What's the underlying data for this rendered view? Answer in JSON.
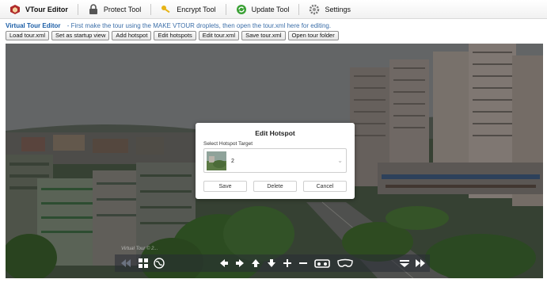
{
  "menu": {
    "items": [
      {
        "label": "VTour Editor",
        "icon": "vtour-logo-icon",
        "active": true
      },
      {
        "label": "Protect Tool",
        "icon": "lock-icon"
      },
      {
        "label": "Encrypt Tool",
        "icon": "key-icon"
      },
      {
        "label": "Update Tool",
        "icon": "update-icon"
      },
      {
        "label": "Settings",
        "icon": "gear-icon"
      }
    ]
  },
  "info": {
    "title": "Virtual Tour Editor",
    "text": "- First make the tour using the MAKE VTOUR droplets, then open the tour.xml here for editing."
  },
  "toolbar": {
    "load": "Load tour.xml",
    "startup": "Set as startup view",
    "add_hotspot": "Add hotspot",
    "edit_hotspots": "Edit hotspots",
    "edit_tour": "Edit tour.xml",
    "save_tour": "Save tour.xml",
    "open_folder": "Open tour folder"
  },
  "viewer": {
    "watermark": "Virtual Tour © 2..."
  },
  "modal": {
    "title": "Edit Hotspot",
    "select_label": "Select Hotspot Target",
    "selected_value": "2",
    "save": "Save",
    "delete": "Delete",
    "cancel": "Cancel"
  },
  "controls": [
    "skip-back-icon",
    "thumbnails-icon",
    "globe-icon",
    "arrow-left-icon",
    "arrow-right-icon",
    "arrow-up-icon",
    "arrow-down-icon",
    "zoom-in-icon",
    "zoom-out-icon",
    "vr-icon",
    "mask-icon",
    "hide-controls-icon",
    "skip-forward-icon"
  ],
  "colors": {
    "info_title": "#1a5da6",
    "info_text": "#3b6ea8"
  }
}
